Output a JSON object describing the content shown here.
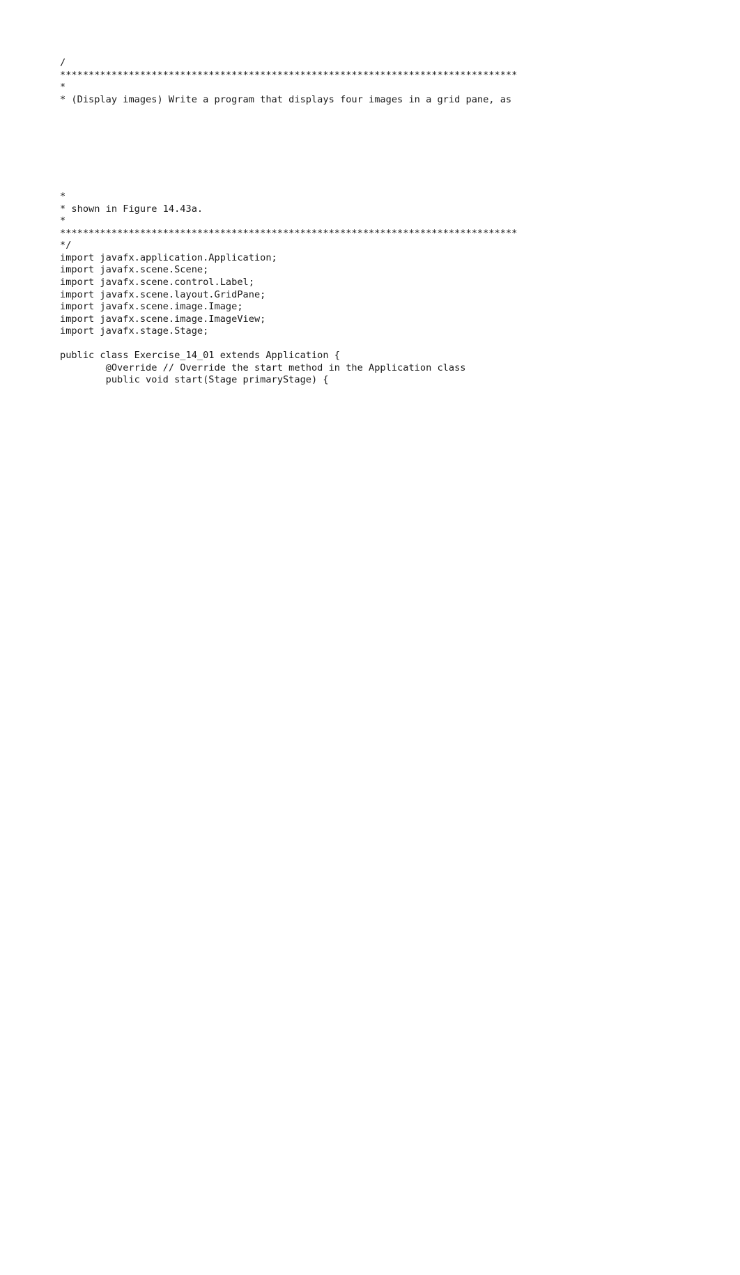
{
  "document": {
    "kind": "source-code-listing",
    "language": "Java",
    "class_name": "Exercise_14_01",
    "background_color": "#ffffff",
    "text_color": "#1a1a1a"
  },
  "code": {
    "header_comment": [
      "/",
      "********************************************************************************",
      "*",
      "* (Display images) Write a program that displays four images in a grid pane, as"
    ],
    "header_comment_continued": [
      "*",
      "* shown in Figure 14.43a.",
      "*",
      "********************************************************************************",
      "*/"
    ],
    "imports": [
      "import javafx.application.Application;",
      "import javafx.scene.Scene;",
      "import javafx.scene.control.Label;",
      "import javafx.scene.layout.GridPane;",
      "import javafx.scene.image.Image;",
      "import javafx.scene.image.ImageView;",
      "import javafx.stage.Stage;"
    ],
    "blank_after_imports": "",
    "class_declaration": "public class Exercise_14_01 extends Application {",
    "method_lines": [
      "        @Override // Override the start method in the Application class",
      "        public void start(Stage primaryStage) {"
    ]
  },
  "redacted_body": {
    "note": "blurred / illegible region",
    "lines": [
      "                                                        ",
      "                                            ",
      "                            ",
      "",
      "                            ",
      "                                                      ",
      "                                                            ",
      "                                                        ",
      "",
      "                                            ",
      "                                ",
      "                                                        ",
      "                                                  ",
      "                                      "
    ]
  },
  "redacted_tail": {
    "lines": [
      "    ",
      "  "
    ]
  }
}
